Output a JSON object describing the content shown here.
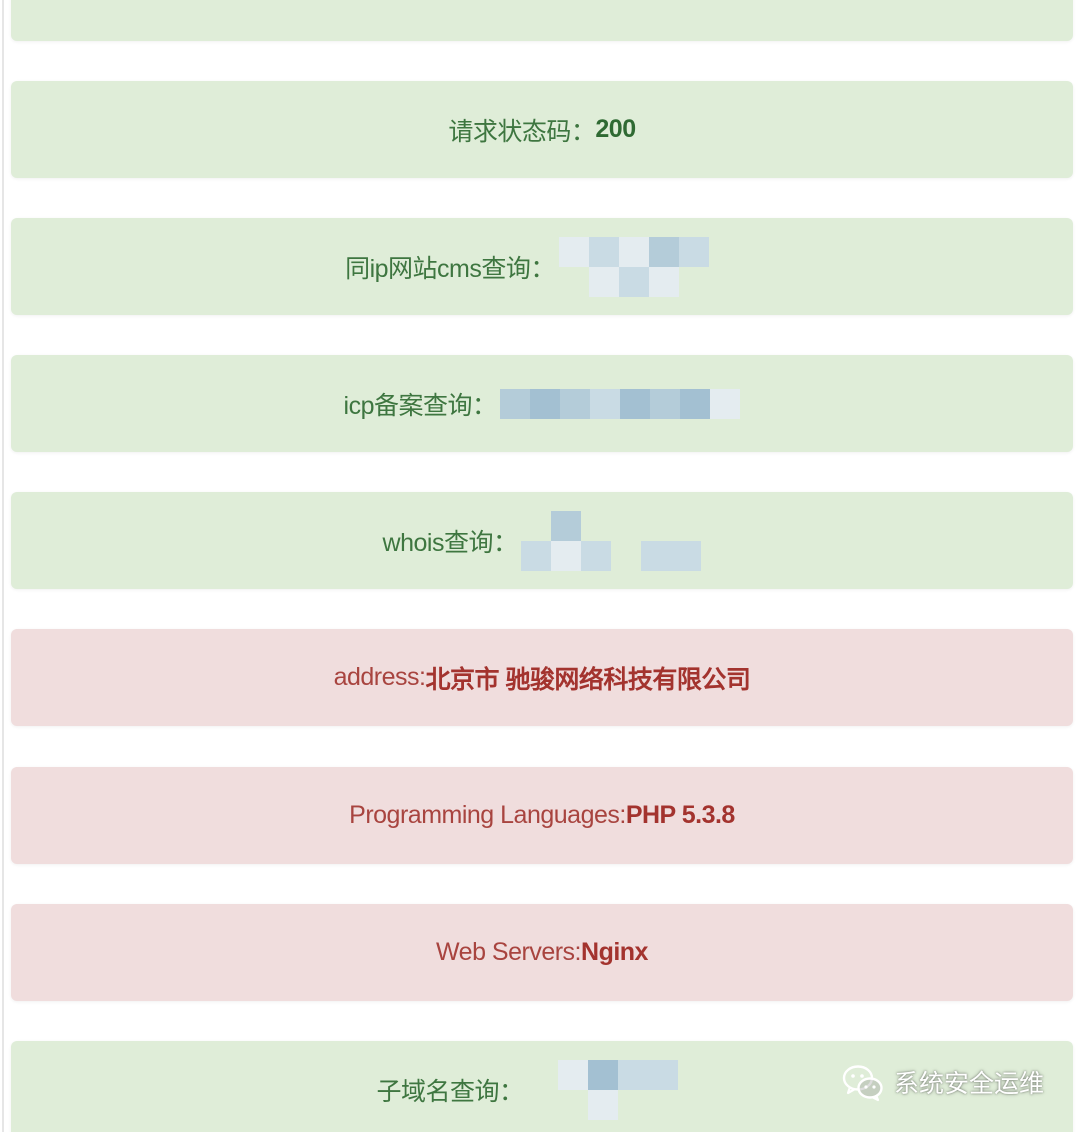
{
  "rows": [
    {
      "label": "",
      "value": "",
      "variant": "success"
    },
    {
      "label": "请求状态码：",
      "value": "200",
      "variant": "success"
    },
    {
      "label": "同ip网站cms查询：",
      "value": "",
      "variant": "success"
    },
    {
      "label": "icp备案查询：",
      "value": "",
      "variant": "success"
    },
    {
      "label": "whois查询：",
      "value": "",
      "variant": "success"
    },
    {
      "label": "address:",
      "value": "北京市 驰骏网络科技有限公司",
      "variant": "danger"
    },
    {
      "label": "Programming Languages:",
      "value": "PHP 5.3.8",
      "variant": "danger"
    },
    {
      "label": "Web Servers:",
      "value": "Nginx",
      "variant": "danger"
    },
    {
      "label": "子域名查询：",
      "value": "",
      "variant": "success"
    }
  ],
  "watermark": {
    "icon": "wechat-icon",
    "text": "系统安全运维"
  },
  "colors": {
    "success_bg": "#dfedd8",
    "success_text": "#3e7640",
    "danger_bg": "#f0dddd",
    "danger_text": "#a8443f"
  }
}
